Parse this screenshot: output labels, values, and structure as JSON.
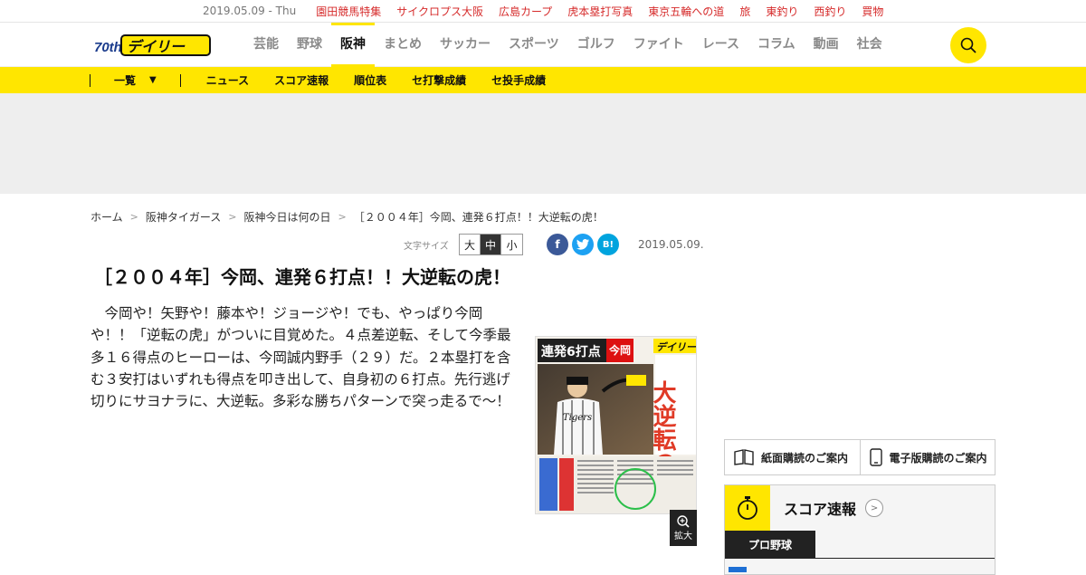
{
  "topbar": {
    "date": "2019.05.09 - Thu",
    "links": [
      "園田競馬特集",
      "サイクロプス大阪",
      "広島カープ",
      "虎本塁打写真",
      "東京五輪への道",
      "旅",
      "東釣り",
      "西釣り",
      "買物"
    ]
  },
  "header": {
    "logo_text": "デイリー",
    "logo_anniv": "70th",
    "nav": [
      "芸能",
      "野球",
      "阪神",
      "まとめ",
      "サッカー",
      "スポーツ",
      "ゴルフ",
      "ファイト",
      "レース",
      "コラム",
      "動画",
      "社会"
    ],
    "active_nav": "阪神"
  },
  "subnav": {
    "list_label": "一覧",
    "items": [
      "ニュース",
      "スコア速報",
      "順位表",
      "セ打撃成績",
      "セ投手成績"
    ]
  },
  "breadcrumb": [
    "ホーム",
    "阪神タイガース",
    "阪神今日は何の日",
    "［２００４年］今岡、連発６打点！！大逆転の虎！"
  ],
  "meta": {
    "font_size_label": "文字サイズ",
    "font_sizes": [
      "大",
      "中",
      "小"
    ],
    "font_size_selected": "中",
    "share": {
      "facebook": "f",
      "twitter": "t",
      "hatena": "B!"
    },
    "date": "2019.05.09."
  },
  "article": {
    "headline": "［２００４年］今岡、連発６打点！！大逆転の虎！",
    "body": "今岡や！矢野や！藤本や！ジョージや！でも、やっぱり今岡や！！「逆転の虎」がついに目覚めた。４点差逆転、そして今季最多１６得点のヒーローは、今岡誠内野手（２９）だ。２本塁打を含む３安打はいずれも得点を叩き出して、自身初の６打点。先行逃げ切りにサヨナラに、大逆転。多彩な勝ちパターンで突っ走るで～！",
    "image": {
      "heading_left": "連発6打点",
      "heading_right": "大逆転の虎",
      "masthead": "デイリー",
      "jersey": "Tigers",
      "subhead": "今岡"
    },
    "zoom_label": "拡大"
  },
  "sidebar": {
    "subscribe_print": "紙面購読のご案内",
    "subscribe_digital": "電子版購読のご案内",
    "score_title": "スコア速報",
    "score_tab": "プロ野球"
  },
  "colors": {
    "accent_yellow": "#ffe600",
    "link_red": "#d62b2b",
    "paper_red": "#e03a26"
  }
}
